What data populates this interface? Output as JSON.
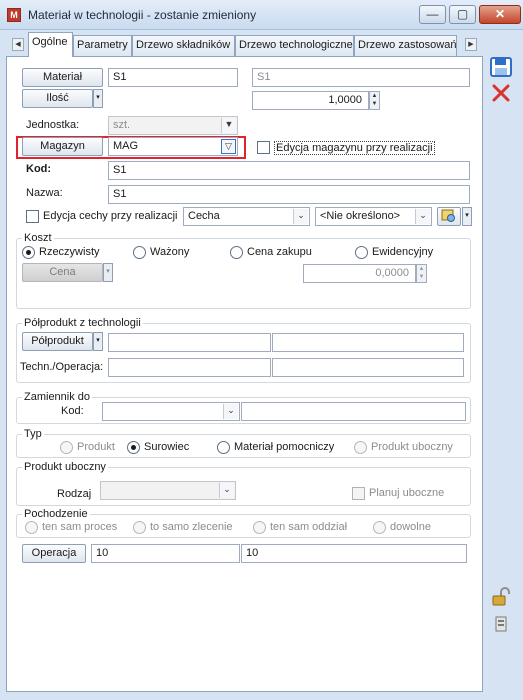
{
  "window": {
    "title": "Materiał w technologii - zostanie zmieniony",
    "icon_label": "M",
    "min_symbol": "—",
    "max_symbol": "▢",
    "close_symbol": "✕"
  },
  "tabs": {
    "left_arrow": "◀",
    "right_arrow": "▶",
    "items": [
      "Ogólne",
      "Parametry",
      "Drzewo składników",
      "Drzewo technologiczne",
      "Drzewo zastosowań"
    ]
  },
  "form": {
    "material_button": "Materiał",
    "material_code": "S1",
    "material_code_secondary": "S1",
    "quantity_button": "Ilość",
    "quantity_value": "1,0000",
    "unit_label": "Jednostka:",
    "unit_value": "szt.",
    "warehouse_button": "Magazyn",
    "warehouse_value": "MAG",
    "warehouse_edit_label": "Edycja magazynu przy realizacji",
    "code_label": "Kod:",
    "code_value": "S1",
    "name_label": "Nazwa:",
    "name_value": "S1",
    "feature_edit_label": "Edycja cechy przy realizacji",
    "feature_value": "Cecha",
    "feature_undefined": "<Nie określono>"
  },
  "koszt": {
    "title": "Koszt",
    "options": [
      "Rzeczywisty",
      "Ważony",
      "Cena zakupu",
      "Ewidencyjny"
    ],
    "selected": "Rzeczywisty",
    "price_button": "Cena",
    "price_value": "0,0000"
  },
  "polprodukt": {
    "title": "Półprodukt z technologii",
    "button": "Półprodukt",
    "techn_label": "Techn./Operacja:"
  },
  "zamiennik": {
    "title": "Zamiennik do",
    "code_label": "Kod:"
  },
  "typ": {
    "title": "Typ",
    "options": [
      "Produkt",
      "Surowiec",
      "Materiał pomocniczy",
      "Produkt uboczny"
    ],
    "selected": "Surowiec"
  },
  "produkt_uboczny": {
    "title": "Produkt uboczny",
    "kind_label": "Rodzaj",
    "plan_label": "Planuj uboczne"
  },
  "pochodzenie": {
    "title": "Pochodzenie",
    "options": [
      "ten sam proces",
      "to samo zlecenie",
      "ten sam oddział",
      "dowolne"
    ]
  },
  "operacja": {
    "button": "Operacja",
    "value1": "10",
    "value2": "10"
  },
  "colors": {
    "highlight": "#e0242e",
    "save_icon": "#2f6fc5",
    "delete_icon": "#d8332c"
  }
}
